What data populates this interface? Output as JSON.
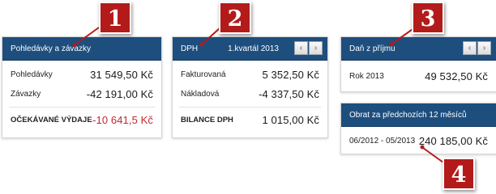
{
  "markers": [
    "1",
    "2",
    "3",
    "4"
  ],
  "receivables": {
    "title": "Pohledávky a závazky",
    "rows": [
      {
        "label": "Pohledávky",
        "value": "31 549,50 Kč"
      },
      {
        "label": "Závazky",
        "value": "-42 191,00 Kč"
      }
    ],
    "total": {
      "label": "OČEKÁVANÉ VÝDAJE",
      "value": "-10 641,5 Kč"
    }
  },
  "vat": {
    "title": "DPH",
    "period": "1.kvartál 2013",
    "prev_icon": "chevron-left-icon",
    "next_icon": "chevron-right-icon",
    "prev_glyph": "‹",
    "next_glyph": "›",
    "rows": [
      {
        "label": "Fakturovaná",
        "value": "5 352,50 Kč"
      },
      {
        "label": "Nákladová",
        "value": "-4 337,50 Kč"
      }
    ],
    "total": {
      "label": "BILANCE DPH",
      "value": "1 015,00 Kč"
    }
  },
  "income_tax": {
    "title": "Daň z příjmu",
    "prev_glyph": "‹",
    "next_glyph": "›",
    "row": {
      "label": "Rok 2013",
      "value": "49 532,50 Kč"
    }
  },
  "turnover": {
    "title": "Obrat za předchozích 12 měsíců",
    "row": {
      "label": "06/2012 - 05/2013",
      "value": "240 185,00 Kč"
    }
  },
  "colors": {
    "header": "#1d4e7e",
    "marker": "#b31b1b",
    "negative": "#c0272d"
  }
}
